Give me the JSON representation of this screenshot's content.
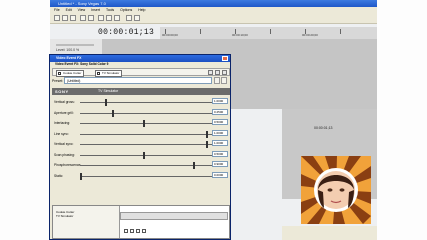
{
  "window": {
    "title": "Untitled * - Sony Vegas 7.0"
  },
  "timeline": {
    "timecode": "00:00:01;13",
    "ruler_labels": [
      "00:00:00;00",
      "00:00:10;00",
      "00:00:20;00"
    ],
    "preview_timecode": "00:00:01;13",
    "tracks": [
      {
        "level": "Level: 100.0 %"
      },
      {
        "level": "Level: 100.0 %"
      },
      {
        "level": "Level: 100.0 %"
      }
    ]
  },
  "media_browser": {
    "items": [
      "Glint",
      "Linear Blur",
      "Mask Generator",
      "Median",
      "Min and Max",
      "Newsprint",
      "Pixelate",
      "Radial Blur",
      "Sepia",
      "Sharpen",
      "Soft Contrast",
      "Spherize",
      "TV Simulator",
      "Wave",
      "Levels",
      "Saturation Adjust",
      "Sharp Mask",
      "Sony Plug-In Broadcast Colors",
      "Sony Plug-In Color Corrector"
    ]
  },
  "dialog": {
    "title": "Video Event FX",
    "subtitle": "Video Event FX: Sony Solid Color 9",
    "chain": [
      "Cookie Cutter",
      "TV Simulator"
    ],
    "preset_label": "Preset:",
    "preset_value": "(Untitled)",
    "brand": "SONY",
    "plugin_name": "TV Simulator",
    "params": [
      {
        "label": "Vertical gross:",
        "value": "1.0000",
        "level": 0.2
      },
      {
        "label": "Aperture grill:",
        "value": "0.2500",
        "level": 0.25
      },
      {
        "label": "Interlacing:",
        "value": "0.5000",
        "level": 0.5
      },
      {
        "label": "Line sync:",
        "value": "1.0000",
        "level": 1.0
      },
      {
        "label": "Vertical sync:",
        "value": "1.0000",
        "level": 1.0
      },
      {
        "label": "Scan phasing:",
        "value": "0.5000",
        "level": 0.5
      },
      {
        "label": "Phosphorescence:",
        "value": "0.9000",
        "level": 0.9
      },
      {
        "label": "Static:",
        "value": "0.0000",
        "level": 0.0
      }
    ],
    "bottom_items": [
      "Cookie Cutter",
      "TV Simulator"
    ]
  },
  "colors": {
    "title_blue": "#1f58c8",
    "dialog_bg": "#ece9d8",
    "sony_header": "#6b6b6b"
  }
}
